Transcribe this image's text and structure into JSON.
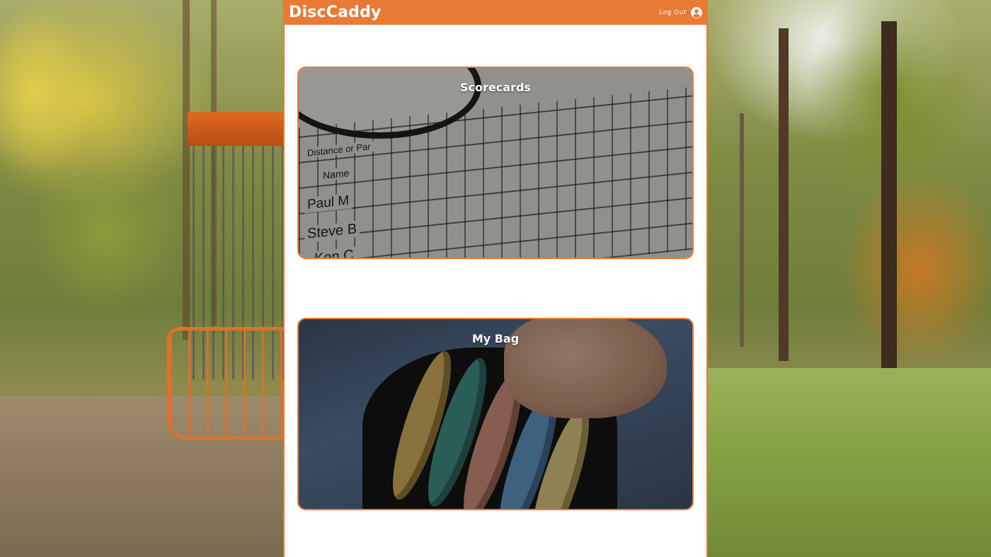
{
  "header": {
    "brand": "DiscCaddy",
    "logout_label": "Log Out",
    "user_icon": "user-circle-icon"
  },
  "cards": [
    {
      "title": "Scorecards",
      "image_text": [
        "Paul M",
        "Steve B",
        "Ken C",
        "Name",
        "Distance or Par"
      ]
    },
    {
      "title": "My Bag"
    }
  ],
  "colors": {
    "accent": "#e87a36",
    "panel": "#ffffff",
    "text_on_accent": "#ffffff"
  }
}
